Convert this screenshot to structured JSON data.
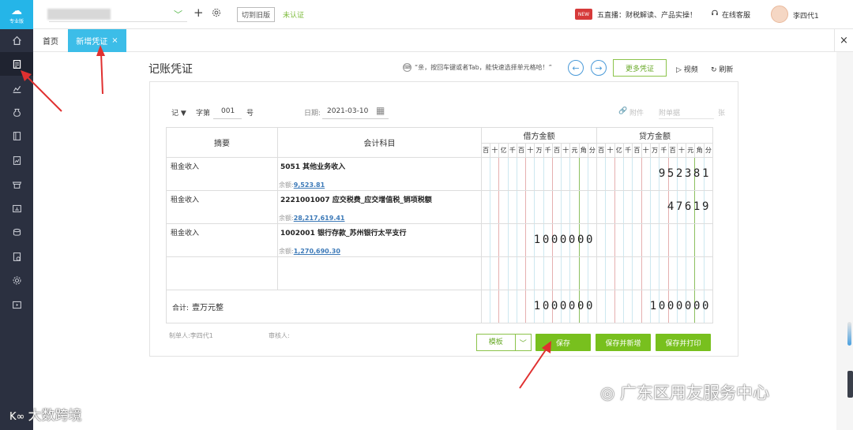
{
  "sidebar": {
    "logo_text": "专业版",
    "items": [
      "home-icon",
      "voucher-icon",
      "chart-icon",
      "money-bag-icon",
      "ledger-icon",
      "report-icon",
      "store-icon",
      "asset-icon",
      "cash-icon",
      "invoice-icon",
      "settings-icon",
      "video-icon"
    ],
    "active_index": 1
  },
  "topbar": {
    "old_version": "切到旧版",
    "unverified": "未认证",
    "news_badge": "NEW",
    "news": "五直播：财税解读、产品实操！",
    "service": "在线客服",
    "username": "李四代1"
  },
  "tabs": {
    "home": "首页",
    "active": "新增凭证",
    "active_close": "×",
    "close_all": "×"
  },
  "page": {
    "title": "记账凭证",
    "tip": "“亲，按回车键或者Tab，能快速选择单元格哈！”",
    "prev": "←",
    "next": "→",
    "more": "更多凭证",
    "video": "视频",
    "refresh": "刷新"
  },
  "voucher": {
    "word": "记",
    "word_no_label": "字第",
    "number": "001",
    "number_suffix": "号",
    "date_label": "日期:",
    "date": "2021-03-10",
    "attach_label": "附件",
    "attach_count_label": "附单据",
    "attach_unit": "张",
    "col_summary": "摘要",
    "col_account": "会计科目",
    "col_debit": "借方金额",
    "col_credit": "贷方金额",
    "digit_units": [
      "百",
      "十",
      "亿",
      "千",
      "百",
      "十",
      "万",
      "千",
      "百",
      "十",
      "元",
      "角",
      "分"
    ],
    "balance_label": "余额:",
    "rows": [
      {
        "summary": "租金收入",
        "account": "5051 其他业务收入",
        "balance": "9,523.81",
        "debit": "",
        "credit": "952381"
      },
      {
        "summary": "租金收入",
        "account": "2221001007 应交税费_应交增值税_销项税额",
        "balance": "28,217,619.41",
        "debit": "",
        "credit": "47619"
      },
      {
        "summary": "租金收入",
        "account": "1002001 银行存款_苏州银行太平支行",
        "balance": "1,270,690.30",
        "debit": "1000000",
        "credit": ""
      },
      {
        "summary": "",
        "account": "",
        "balance": "",
        "debit": "",
        "credit": ""
      }
    ],
    "total_label": "合计:",
    "total_words": "壹万元整",
    "total_debit": "1000000",
    "total_credit": "1000000",
    "maker_label": "制单人:",
    "maker": "李四代1",
    "auditor_label": "审核人:"
  },
  "actions": {
    "template": "模板",
    "save": "保存",
    "save_new": "保存并新增",
    "save_print": "保存并打印"
  },
  "watermarks": {
    "right": "广东区用友服务中心",
    "left": "大数跨境"
  },
  "colors": {
    "accent_blue": "#3cbde8",
    "green": "#78c01e",
    "sidebar": "#2b3040",
    "arrow_red": "#e03030"
  }
}
